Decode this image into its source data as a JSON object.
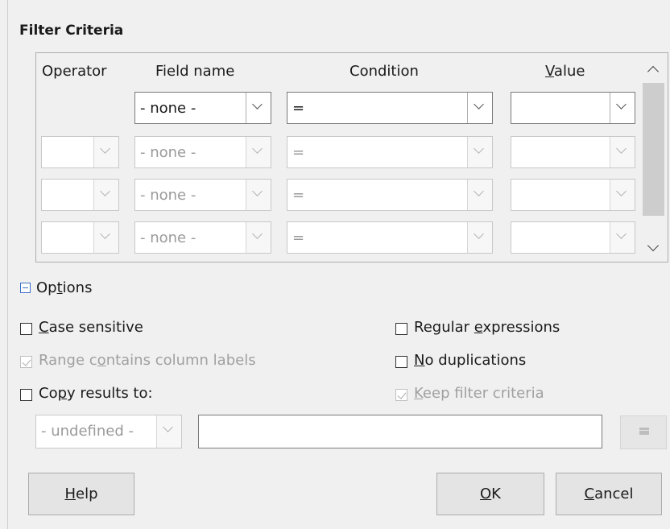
{
  "section": {
    "title": "Filter Criteria"
  },
  "columns": {
    "operator": "Operator",
    "field_name": "Field name",
    "condition": "Condition",
    "value": {
      "accel": "V",
      "rest": "alue"
    }
  },
  "rows": [
    {
      "field": "- none -",
      "condition": "=",
      "value": ""
    },
    {
      "operator": "",
      "field": "- none -",
      "condition": "=",
      "value": ""
    },
    {
      "operator": "",
      "field": "- none -",
      "condition": "=",
      "value": ""
    },
    {
      "operator": "",
      "field": "- none -",
      "condition": "=",
      "value": ""
    }
  ],
  "options": {
    "pre": "Op",
    "accel": "t",
    "post": "ions",
    "expanded": true
  },
  "checkboxes": {
    "case_sensitive": {
      "accel": "C",
      "rest": "ase sensitive",
      "checked": false
    },
    "range_labels": {
      "pre": "Range c",
      "accel": "o",
      "post": "ntains column labels",
      "checked": true,
      "disabled": true
    },
    "copy_results": {
      "pre": "Co",
      "accel": "p",
      "post": "y results to:",
      "checked": false
    },
    "regex": {
      "pre": "Regular ",
      "accel": "e",
      "post": "xpressions",
      "checked": false
    },
    "no_dup": {
      "accel": "N",
      "rest": "o duplications",
      "checked": false
    },
    "keep_filter": {
      "accel": "K",
      "rest": "eep filter criteria",
      "checked": true,
      "disabled": true
    }
  },
  "copy_target": {
    "selected": "- undefined -",
    "value": ""
  },
  "buttons": {
    "help": {
      "accel": "H",
      "rest": "elp"
    },
    "ok": {
      "accel": "O",
      "rest": "K"
    },
    "cancel": {
      "accel": "C",
      "rest": "ancel"
    }
  },
  "colors": {
    "accent": "#3c6ec7",
    "background": "#f0f0f0",
    "disabled_text": "#a0a0a0"
  }
}
